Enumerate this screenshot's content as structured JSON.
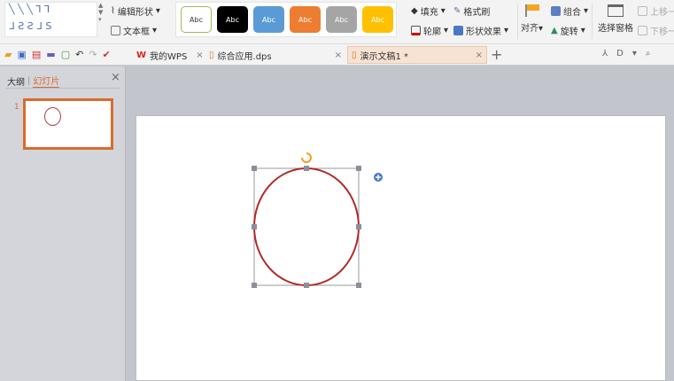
{
  "ribbon": {
    "edit_shape": "编辑形状",
    "text_box": "文本框",
    "style_label": "Abc",
    "fill": "填充",
    "format_painter": "格式刷",
    "outline": "轮廓",
    "shape_effects": "形状效果",
    "align": "对齐",
    "group": "组合",
    "rotate": "旋转",
    "selection_pane": "选择窗格",
    "bring_forward": "上移一",
    "send_backward": "下移一"
  },
  "style_colors": [
    "#ffffff",
    "#000000",
    "#5b9bd5",
    "#ed7d31",
    "#a5a5a5",
    "#ffc000"
  ],
  "tabs": [
    {
      "label": "我的WPS"
    },
    {
      "label": "综合应用.dps"
    },
    {
      "label": "演示文稿1 *"
    }
  ],
  "panel": {
    "tab_outline": "大纲",
    "tab_slides": "幻灯片",
    "slide_number": "1"
  },
  "accent": "#d86c2b"
}
